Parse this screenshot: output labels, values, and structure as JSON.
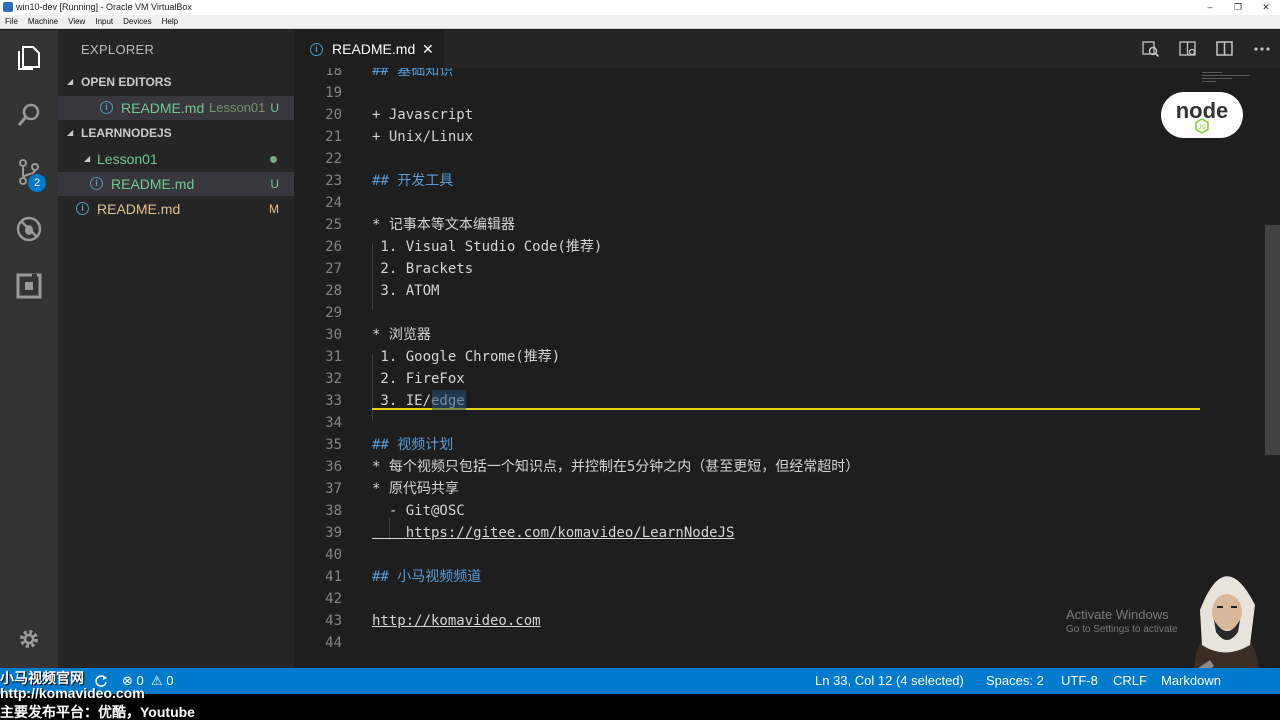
{
  "window": {
    "title": "win10-dev [Running] - Oracle VM VirtualBox",
    "controls": [
      "–",
      "❐",
      "✕"
    ],
    "menu": [
      "File",
      "Machine",
      "View",
      "Input",
      "Devices",
      "Help"
    ]
  },
  "activity_bar": {
    "items": [
      {
        "name": "explorer",
        "icon": "files-icon"
      },
      {
        "name": "search",
        "icon": "search-icon"
      },
      {
        "name": "source-control",
        "icon": "git-icon",
        "badge": "2"
      },
      {
        "name": "debug",
        "icon": "no-bug-icon"
      },
      {
        "name": "extensions",
        "icon": "extensions-icon"
      }
    ],
    "bottom_icon": "gear-icon"
  },
  "sidebar": {
    "title": "EXPLORER",
    "open_editors": {
      "label": "OPEN EDITORS",
      "items": [
        {
          "name": "README.md",
          "description": "Lesson01",
          "status": "U"
        }
      ]
    },
    "project": {
      "label": "LEARNNODEJS",
      "folder": "Lesson01",
      "items": [
        {
          "name": "README.md",
          "status": "U"
        },
        {
          "name": "README.md",
          "status": "M"
        }
      ]
    }
  },
  "tab": {
    "label": "README.md",
    "close": "✕"
  },
  "editor": {
    "lines": [
      {
        "n": "18",
        "text": "## 基础知识"
      },
      {
        "n": "19",
        "text": ""
      },
      {
        "n": "20",
        "text": "+ Javascript"
      },
      {
        "n": "21",
        "text": "+ Unix/Linux"
      },
      {
        "n": "22",
        "text": ""
      },
      {
        "n": "23",
        "text": "## 开发工具"
      },
      {
        "n": "24",
        "text": ""
      },
      {
        "n": "25",
        "text": "* 记事本等文本编辑器"
      },
      {
        "n": "26",
        "text": " 1. Visual Studio Code(推荐)"
      },
      {
        "n": "27",
        "text": " 2. Brackets"
      },
      {
        "n": "28",
        "text": " 3. ATOM"
      },
      {
        "n": "29",
        "text": ""
      },
      {
        "n": "30",
        "text": "* 浏览器"
      },
      {
        "n": "31",
        "text": " 1. Google Chrome(推荐)"
      },
      {
        "n": "32",
        "text": " 2. FireFox"
      },
      {
        "n": "33",
        "text": " 3. IE/edge"
      },
      {
        "n": "34",
        "text": ""
      },
      {
        "n": "35",
        "text": "## 视频计划"
      },
      {
        "n": "36",
        "text": "* 每个视频只包括一个知识点，并控制在5分钟之内（甚至更短，但经常超时）"
      },
      {
        "n": "37",
        "text": "* 原代码共享"
      },
      {
        "n": "38",
        "text": "  - Git@OSC"
      },
      {
        "n": "39",
        "text": "    https://gitee.com/komavideo/LearnNodeJS"
      },
      {
        "n": "40",
        "text": ""
      },
      {
        "n": "41",
        "text": "## 小马视频频道"
      },
      {
        "n": "42",
        "text": ""
      },
      {
        "n": "43",
        "text": "http://komavideo.com"
      },
      {
        "n": "44",
        "text": ""
      }
    ]
  },
  "logo": {
    "text": "node",
    "sub": "JS"
  },
  "watermark": {
    "line1": "Activate Windows",
    "line2": "Go to Settings to activate"
  },
  "status": {
    "errors": "0",
    "warnings": "0",
    "position": "Ln 33, Col 12 (4 selected)",
    "spaces": "Spaces: 2",
    "encoding": "UTF-8",
    "eol": "CRLF",
    "language": "Markdown"
  },
  "overlay": {
    "line1": "小马视频官网",
    "line2": "http://komavideo.com",
    "line3": "主要发布平台：优酷，Youtube"
  },
  "colors": {
    "status_bar": "#007acc",
    "activity_bar": "#333333",
    "sidebar": "#252526",
    "editor": "#1e1e1e",
    "heading": "#569cd6",
    "cursor_line": "#e6d400"
  }
}
